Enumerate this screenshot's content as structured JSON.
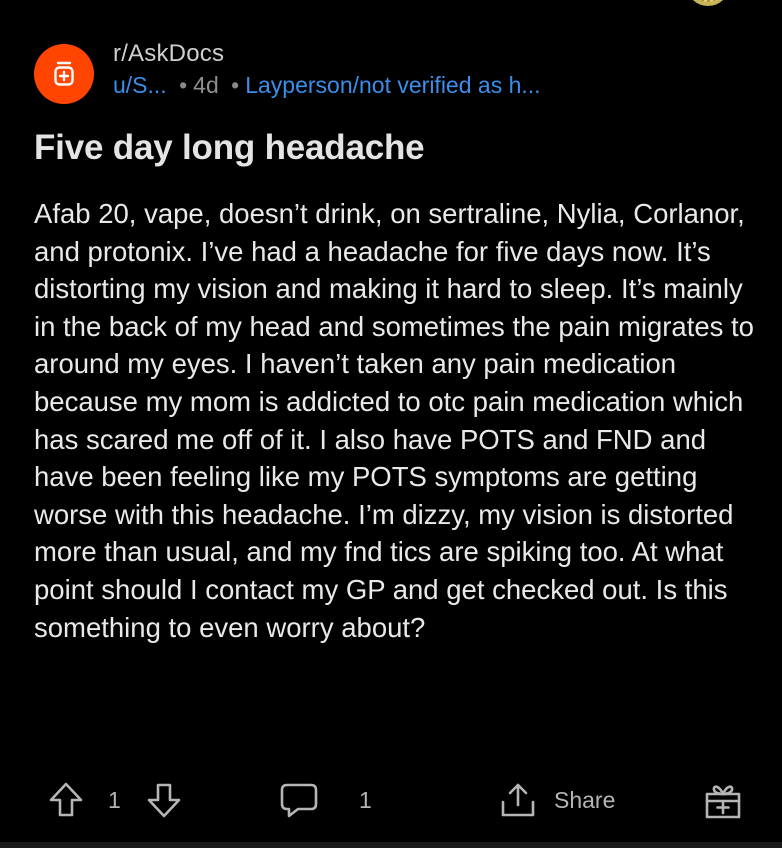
{
  "post": {
    "subreddit": "r/AskDocs",
    "username": "u/S...",
    "separator": "•",
    "age": "4d",
    "flair": "Layperson/not verified as h...",
    "title": "Five day long headache",
    "body": "Afab 20, vape, doesn’t drink, on sertraline, Nylia, Corlanor, and protonix. I’ve had a headache for five days now. It’s distorting my vision and making it hard to sleep. It’s mainly in the back of my head and sometimes the pain migrates to around my eyes. I haven’t taken any pain medication because my mom is addicted to otc pain medication which has scared me off of it. I also have POTS and FND and have been feeling like my POTS symptoms are getting worse with this headache. I’m dizzy, my vision is distorted more than usual, and my fnd tics are spiking too. At what point should I contact my GP and get checked out. Is this something to even worry about?"
  },
  "actions": {
    "vote_count": "1",
    "comment_count": "1",
    "share_label": "Share"
  },
  "colors": {
    "background": "#000000",
    "subreddit_avatar": "#ff4500",
    "link_blue": "#3b8eea",
    "icon_gray": "#b5b5b5"
  },
  "icons": {
    "subreddit_avatar": "reddit-jar-icon",
    "upvote": "arrow-up-icon",
    "downvote": "arrow-down-icon",
    "comment": "speech-bubble-icon",
    "share": "share-icon",
    "award": "gift-award-icon"
  }
}
